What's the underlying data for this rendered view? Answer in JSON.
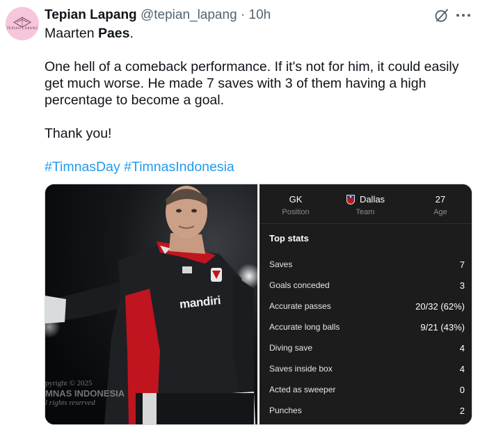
{
  "author": {
    "name": "Tepian Lapang",
    "handle": "@tepian_lapang",
    "separator": "·",
    "time": "10h",
    "avatar_text": "TEPIAN LAPANG"
  },
  "icons": {
    "grok": "grok-icon",
    "more": "more-options-icon"
  },
  "tweet": {
    "line1_prefix": "Maarten ",
    "line1_bold": "Paes",
    "line1_suffix": ".",
    "paragraph": "One hell of a comeback performance. If it's not for him, it could easily get much worse. He made 7 saves with 3 of them having a high percentage to become a goal.",
    "thanks": "Thank you!",
    "hashtags": [
      "#TimnasDay",
      "#TimnasIndonesia"
    ]
  },
  "photo": {
    "jersey_sponsor": "mandiri",
    "watermark": [
      "pyright © 2025",
      "MNAS INDONESIA",
      "l rights reserved"
    ]
  },
  "stats_card": {
    "position_value": "GK",
    "position_label": "Position",
    "team_value": "Dallas",
    "team_label": "Team",
    "age_value": "27",
    "age_label": "Age",
    "section_title": "Top stats",
    "rows": [
      {
        "label": "Saves",
        "value": "7"
      },
      {
        "label": "Goals conceded",
        "value": "3"
      },
      {
        "label": "Accurate passes",
        "value": "20/32 (62%)"
      },
      {
        "label": "Accurate long balls",
        "value": "9/21 (43%)"
      },
      {
        "label": "Diving save",
        "value": "4"
      },
      {
        "label": "Saves inside box",
        "value": "4"
      },
      {
        "label": "Acted as sweeper",
        "value": "0"
      },
      {
        "label": "Punches",
        "value": "2"
      }
    ]
  },
  "colors": {
    "link": "#1d9bf0",
    "muted": "#536471",
    "card_bg": "#1c1c1c"
  }
}
